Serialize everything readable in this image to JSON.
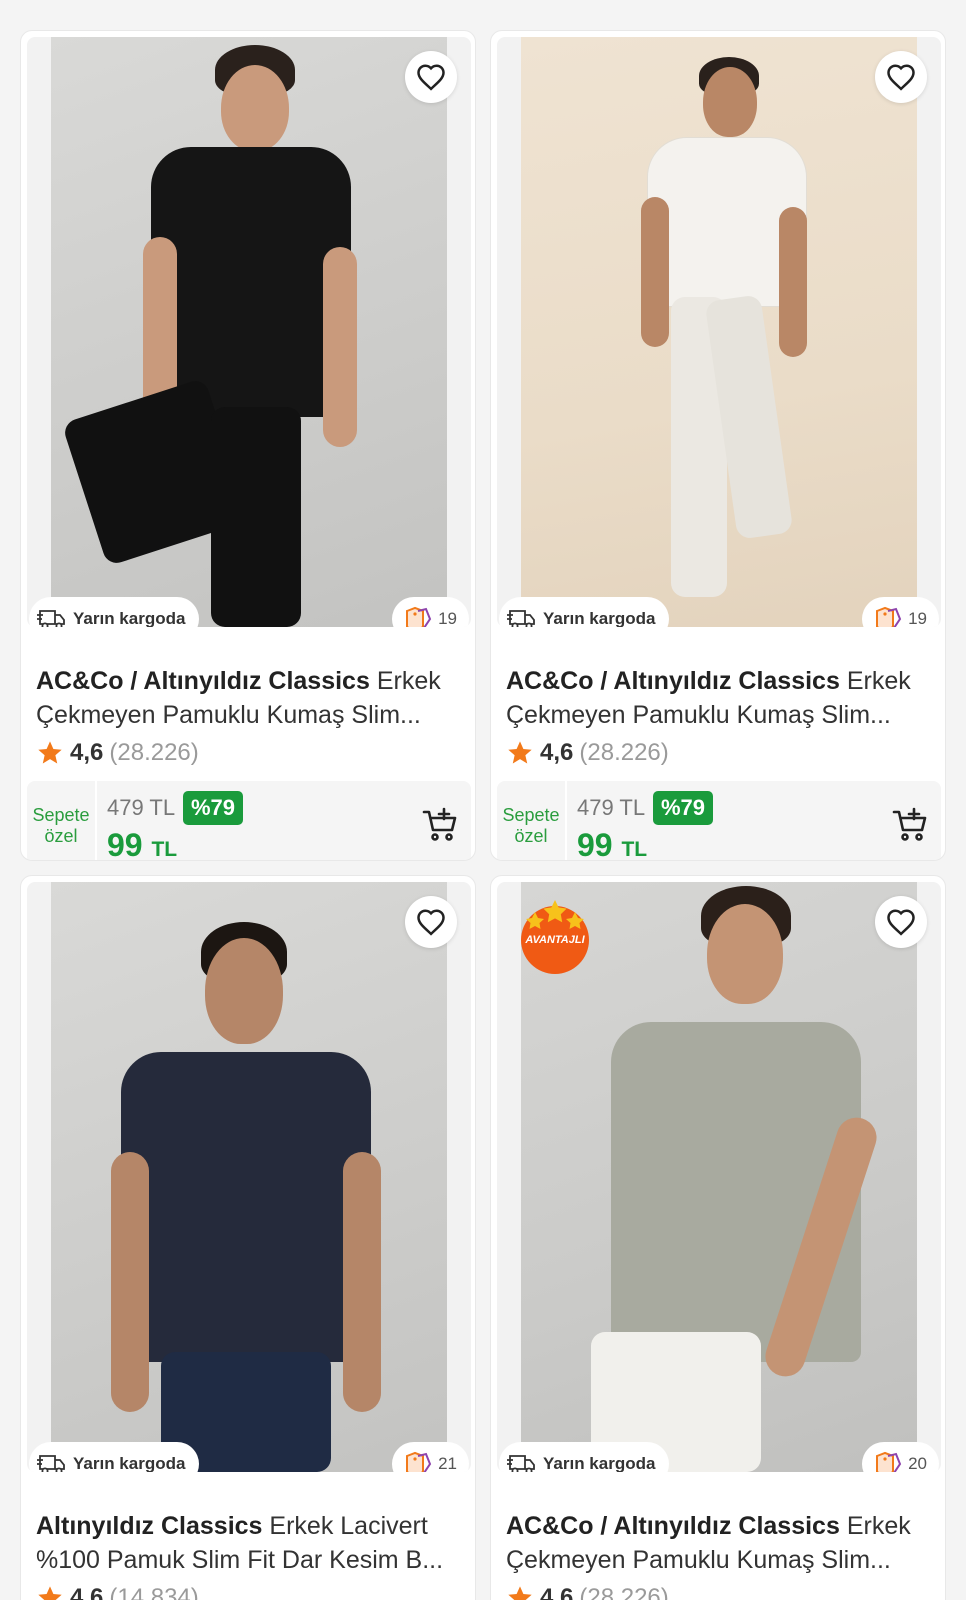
{
  "products": [
    {
      "brand": "AC&Co / Altınyıldız Classics",
      "title_line1": "Erkek",
      "title_line2": "Çekmeyen Pamuklu Kumaş Slim...",
      "rating": "4,6",
      "review_count": "(28.226)",
      "shipping": "Yarın kargoda",
      "coupon_count": "19",
      "special_label_1": "Sepete",
      "special_label_2": "özel",
      "old_price": "479 TL",
      "discount": "%79",
      "price": "99",
      "currency": "TL"
    },
    {
      "brand": "AC&Co / Altınyıldız Classics",
      "title_line1": "Erkek",
      "title_line2": "Çekmeyen Pamuklu Kumaş Slim...",
      "rating": "4,6",
      "review_count": "(28.226)",
      "shipping": "Yarın kargoda",
      "coupon_count": "19",
      "special_label_1": "Sepete",
      "special_label_2": "özel",
      "old_price": "479 TL",
      "discount": "%79",
      "price": "99",
      "currency": "TL"
    },
    {
      "brand": "Altınyıldız Classics",
      "title_line1": "Erkek Lacivert",
      "title_line2": "%100 Pamuk Slim Fit Dar Kesim B...",
      "rating": "4,6",
      "review_count": "(14.834)",
      "shipping": "Yarın kargoda",
      "coupon_count": "21"
    },
    {
      "brand": "AC&Co / Altınyıldız Classics",
      "title_line1": "Erkek",
      "title_line2": "Çekmeyen Pamuklu Kumaş Slim...",
      "rating": "4,6",
      "review_count": "(28.226)",
      "shipping": "Yarın kargoda",
      "coupon_count": "20",
      "badge_label": "AVANTAJLI"
    }
  ],
  "colors": {
    "accent_orange": "#f27a1a",
    "price_green": "#1a9b3c"
  },
  "icons": [
    "heart-icon",
    "truck-icon",
    "coupon-icon",
    "star-icon",
    "add-to-cart-icon",
    "avantajli-badge"
  ]
}
